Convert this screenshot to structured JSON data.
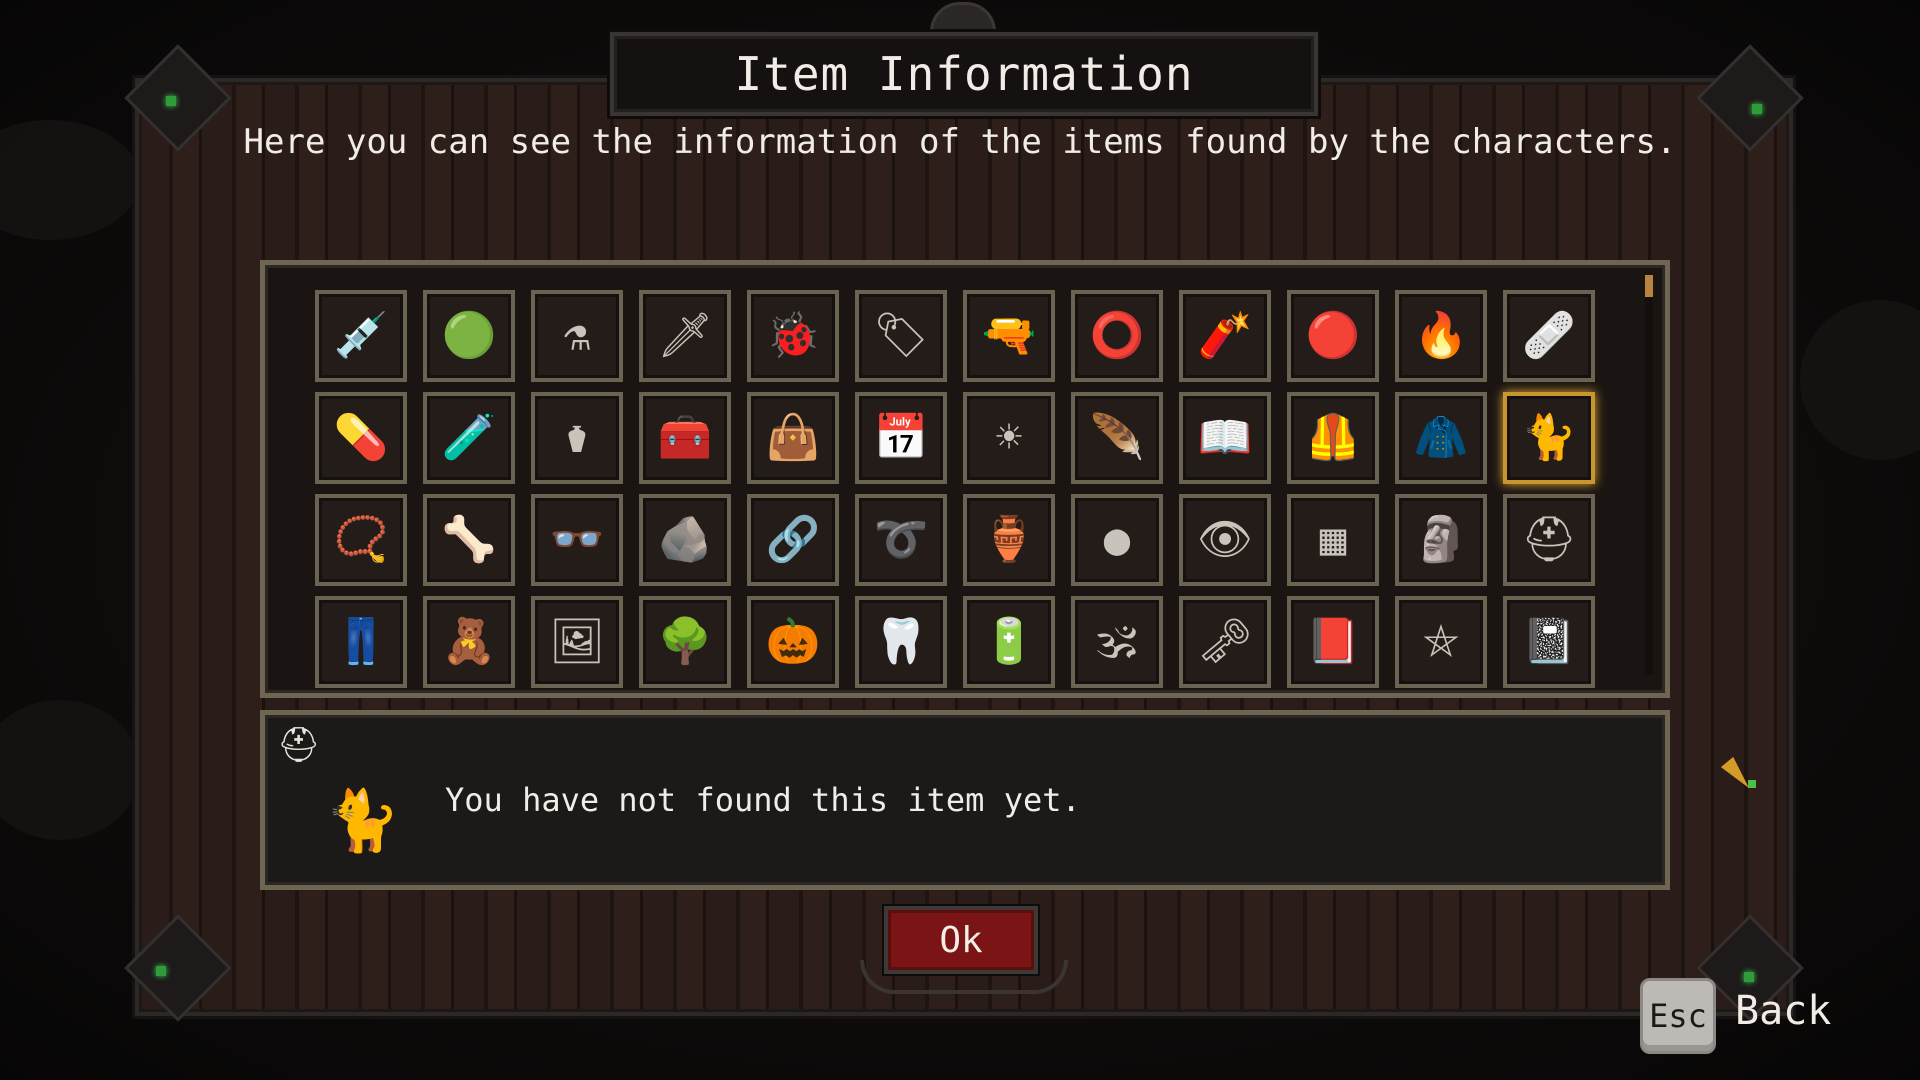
{
  "dialog": {
    "title": "Item Information",
    "subtitle": "Here you can see the information of the items found by the characters.",
    "ok_label": "Ok"
  },
  "info_panel": {
    "character_icon": "character-portrait-icon",
    "selected_item_icon": "cat-figurine-icon",
    "message": "You have not found this item yet."
  },
  "footer": {
    "key_label": "Esc",
    "action_label": "Back"
  },
  "colors": {
    "accent_selected": "#c9962d",
    "ok_button": "#7b1414",
    "frame": "#6e6653",
    "gem": "#2f9b3c"
  },
  "items": [
    {
      "name": "syringe-icon",
      "glyph": "💉",
      "selected": false
    },
    {
      "name": "green-gem-amulet-icon",
      "glyph": "🟢",
      "selected": false
    },
    {
      "name": "potion-flasks-icon",
      "glyph": "⚗",
      "selected": false
    },
    {
      "name": "dagger-icon",
      "glyph": "🗡",
      "selected": false
    },
    {
      "name": "golden-beetle-icon",
      "glyph": "🐞",
      "selected": false
    },
    {
      "name": "dog-tag-icon",
      "glyph": "🏷",
      "selected": false
    },
    {
      "name": "shotgun-icon",
      "glyph": "🔫",
      "selected": false
    },
    {
      "name": "bracelet-icon",
      "glyph": "⭕",
      "selected": false
    },
    {
      "name": "dynamite-icon",
      "glyph": "🧨",
      "selected": false
    },
    {
      "name": "red-button-icon",
      "glyph": "🔴",
      "selected": false
    },
    {
      "name": "lighter-icon",
      "glyph": "🔥",
      "selected": false
    },
    {
      "name": "bandage-box-icon",
      "glyph": "🩹",
      "selected": false
    },
    {
      "name": "medicine-bottle-icon",
      "glyph": "💊",
      "selected": false
    },
    {
      "name": "orange-potion-icon",
      "glyph": "🧪",
      "selected": false
    },
    {
      "name": "sarcophagus-icon",
      "glyph": "⚱",
      "selected": false
    },
    {
      "name": "first-aid-kit-icon",
      "glyph": "🧰",
      "selected": false
    },
    {
      "name": "medic-bag-icon",
      "glyph": "👜",
      "selected": false
    },
    {
      "name": "calendar-icon",
      "glyph": "📅",
      "selected": false
    },
    {
      "name": "sun-medallion-icon",
      "glyph": "☀",
      "selected": false
    },
    {
      "name": "feather-icon",
      "glyph": "🪶",
      "selected": false
    },
    {
      "name": "book-icon",
      "glyph": "📖",
      "selected": false
    },
    {
      "name": "vest-icon",
      "glyph": "🦺",
      "selected": false
    },
    {
      "name": "coat-icon",
      "glyph": "🧥",
      "selected": false
    },
    {
      "name": "cat-figurine-icon",
      "glyph": "🐈",
      "selected": true
    },
    {
      "name": "rosary-icon",
      "glyph": "📿",
      "selected": false
    },
    {
      "name": "claw-icon",
      "glyph": "🦴",
      "selected": false
    },
    {
      "name": "glasses-icon",
      "glyph": "👓",
      "selected": false
    },
    {
      "name": "rock-pile-icon",
      "glyph": "🪨",
      "selected": false
    },
    {
      "name": "necklace-icon",
      "glyph": "🔗",
      "selected": false
    },
    {
      "name": "rope-coil-icon",
      "glyph": "➰",
      "selected": false
    },
    {
      "name": "vase-icon",
      "glyph": "🏺",
      "selected": false
    },
    {
      "name": "rock-icon",
      "glyph": "●",
      "selected": false
    },
    {
      "name": "eyeball-icon",
      "glyph": "👁",
      "selected": false
    },
    {
      "name": "cloth-icon",
      "glyph": "▦",
      "selected": false
    },
    {
      "name": "statue-icon",
      "glyph": "🗿",
      "selected": false
    },
    {
      "name": "helmet-icon",
      "glyph": "⛑",
      "selected": false
    },
    {
      "name": "trousers-icon",
      "glyph": "👖",
      "selected": false
    },
    {
      "name": "teddy-bear-icon",
      "glyph": "🧸",
      "selected": false
    },
    {
      "name": "picture-frame-icon",
      "glyph": "🖼",
      "selected": false
    },
    {
      "name": "tree-icon",
      "glyph": "🌳",
      "selected": false
    },
    {
      "name": "pumpkin-icon",
      "glyph": "🎃",
      "selected": false
    },
    {
      "name": "tooth-icon",
      "glyph": "🦷",
      "selected": false
    },
    {
      "name": "battery-icon",
      "glyph": "🔋",
      "selected": false
    },
    {
      "name": "om-symbol-icon",
      "glyph": "🕉",
      "selected": false
    },
    {
      "name": "key-icon",
      "glyph": "🗝",
      "selected": false
    },
    {
      "name": "grimoire-icon",
      "glyph": "📕",
      "selected": false
    },
    {
      "name": "pentagram-book-icon",
      "glyph": "⛤",
      "selected": false
    },
    {
      "name": "rune-book-icon",
      "glyph": "📓",
      "selected": false
    }
  ]
}
